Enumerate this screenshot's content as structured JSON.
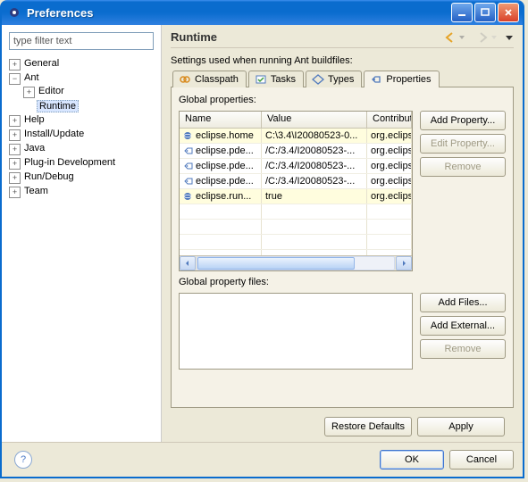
{
  "window": {
    "title": "Preferences"
  },
  "sidebar": {
    "filter_placeholder": "type filter text",
    "items": {
      "general": "General",
      "ant": "Ant",
      "ant_editor": "Editor",
      "ant_runtime": "Runtime",
      "help": "Help",
      "install_update": "Install/Update",
      "java": "Java",
      "plugin_dev": "Plug-in Development",
      "run_debug": "Run/Debug",
      "team": "Team"
    }
  },
  "main": {
    "title": "Runtime",
    "description": "Settings used when running Ant buildfiles:",
    "tabs": {
      "classpath": "Classpath",
      "tasks": "Tasks",
      "types": "Types",
      "properties": "Properties"
    },
    "global_properties_label": "Global properties:",
    "columns": {
      "name": "Name",
      "value": "Value",
      "contrib": "Contribut"
    },
    "rows": [
      {
        "icon": "globe",
        "name": "eclipse.home",
        "value": "C:\\3.4\\I20080523-0...",
        "contrib": "org.eclipse"
      },
      {
        "icon": "tag",
        "name": "eclipse.pde...",
        "value": "/C:/3.4/I20080523-...",
        "contrib": "org.eclipse"
      },
      {
        "icon": "tag",
        "name": "eclipse.pde...",
        "value": "/C:/3.4/I20080523-...",
        "contrib": "org.eclipse"
      },
      {
        "icon": "tag",
        "name": "eclipse.pde...",
        "value": "/C:/3.4/I20080523-...",
        "contrib": "org.eclipse"
      },
      {
        "icon": "globe",
        "name": "eclipse.run...",
        "value": "true",
        "contrib": "org.eclipse"
      }
    ],
    "buttons": {
      "add_property": "Add Property...",
      "edit_property": "Edit Property...",
      "remove_prop": "Remove",
      "add_files": "Add Files...",
      "add_external": "Add External...",
      "remove_file": "Remove"
    },
    "global_files_label": "Global property files:",
    "footer": {
      "restore": "Restore Defaults",
      "apply": "Apply"
    }
  },
  "bottom": {
    "ok": "OK",
    "cancel": "Cancel",
    "help": "?"
  }
}
